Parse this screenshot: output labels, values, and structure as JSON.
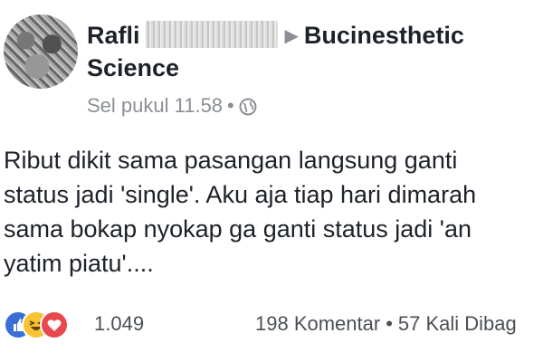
{
  "post": {
    "author_name": "Rafli",
    "page_name_line1": "Bucinesthetic",
    "page_name_line2": "Science",
    "timestamp": "Sel pukul 11.58",
    "separator": "•",
    "privacy_icon": "globe-icon",
    "share_arrow_icon": "triangle-right-icon",
    "text_lines": [
      "Ribut dikit sama pasangan langsung ganti",
      "status jadi 'single'. Aku aja tiap hari dimarah",
      "sama bokap nyokap ga ganti status jadi 'an",
      "yatim piatu'...."
    ]
  },
  "footer": {
    "reaction_icons": [
      "like-icon",
      "haha-icon",
      "love-icon"
    ],
    "reaction_count": "1.049",
    "comments": "198 Komentar",
    "separator": "•",
    "shares": "57 Kali Dibag"
  },
  "colors": {
    "text": "#1d2129",
    "meta": "#8b8f95",
    "like": "#3b6fd8",
    "haha": "#f7c233",
    "love": "#e9484f"
  }
}
